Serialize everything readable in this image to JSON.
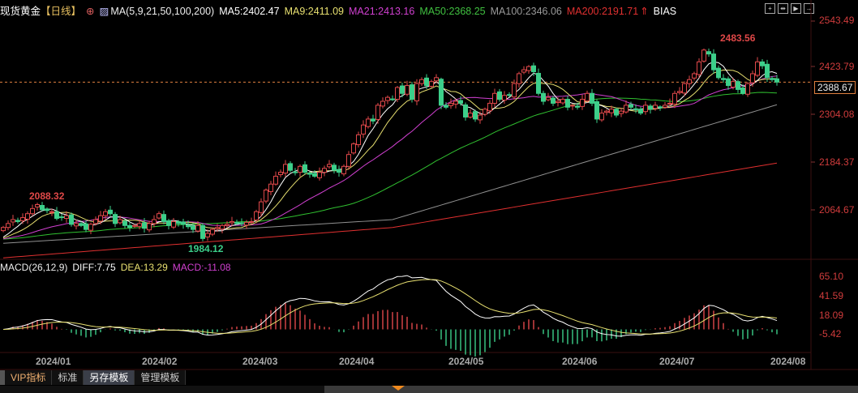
{
  "header": {
    "symbol": "现货黄金",
    "period": "【日线】",
    "ma_label": "MA(5,9,21,50,100,200)",
    "ma5": "MA5:2402.47",
    "ma9": "MA9:2411.09",
    "ma21": "MA21:2413.16",
    "ma50": "MA50:2368.25",
    "ma100": "MA100:2346.06",
    "ma200": "MA200:2191.71",
    "bias": "BIAS"
  },
  "macd_header": {
    "label": "MACD(26,12,9)",
    "diff": "DIFF:7.75",
    "dea": "DEA:13.29",
    "macd": "MACD:-11.08"
  },
  "tabs": [
    "VIP指标",
    "标准",
    "另存模板",
    "管理模板"
  ],
  "colors": {
    "up": "#e0484a",
    "down": "#3ccf8a",
    "ma5": "#ffffff",
    "ma9": "#e8e070",
    "ma21": "#d040d0",
    "ma50": "#30c030",
    "ma100": "#909090",
    "ma200": "#e03030"
  },
  "chart_data": {
    "type": "candlestick",
    "price_axis": {
      "ticks": [
        "2543.49",
        "2423.79",
        "2304.08",
        "2184.37",
        "2064.67"
      ],
      "range": [
        1943,
        2543.49
      ]
    },
    "current_price": "2388.67",
    "annotations": {
      "high1": "2088.32",
      "low1": "1984.12",
      "high2": "2483.56"
    },
    "x_labels": [
      "2024/01",
      "2024/02",
      "2024/03",
      "2024/04",
      "2024/05",
      "2024/06",
      "2024/07",
      "2024/08"
    ],
    "closes": [
      2020,
      2030,
      2040,
      2035,
      2045,
      2055,
      2068,
      2078,
      2065,
      2063,
      2060,
      2043,
      2045,
      2050,
      2028,
      2030,
      2025,
      2015,
      2028,
      2040,
      2050,
      2060,
      2055,
      2030,
      2040,
      2025,
      2020,
      2025,
      2030,
      2018,
      2030,
      2040,
      2055,
      2035,
      2025,
      2035,
      2030,
      2028,
      2022,
      2015,
      2025,
      1992,
      2005,
      2015,
      2020,
      2025,
      2028,
      2035,
      2030,
      2030,
      2033,
      2035,
      2060,
      2085,
      2115,
      2130,
      2150,
      2160,
      2180,
      2165,
      2160,
      2175,
      2160,
      2155,
      2150,
      2160,
      2170,
      2180,
      2165,
      2160,
      2175,
      2205,
      2232,
      2255,
      2280,
      2295,
      2290,
      2330,
      2340,
      2350,
      2345,
      2375,
      2360,
      2380,
      2345,
      2385,
      2395,
      2380,
      2390,
      2400,
      2330,
      2325,
      2335,
      2340,
      2335,
      2300,
      2310,
      2295,
      2305,
      2320,
      2335,
      2360,
      2345,
      2355,
      2355,
      2385,
      2410,
      2420,
      2428,
      2415,
      2360,
      2340,
      2350,
      2335,
      2340,
      2345,
      2325,
      2330,
      2325,
      2345,
      2360,
      2335,
      2295,
      2310,
      2315,
      2320,
      2305,
      2315,
      2330,
      2325,
      2320,
      2310,
      2330,
      2320,
      2330,
      2325,
      2330,
      2335,
      2360,
      2365,
      2385,
      2395,
      2410,
      2440,
      2470,
      2460,
      2420,
      2400,
      2395,
      2380,
      2390,
      2370,
      2360,
      2385,
      2410,
      2440,
      2430,
      2400,
      2395,
      2388.67
    ],
    "ma100_points": [
      [
        0,
        1980
      ],
      [
        80,
        2040
      ],
      [
        163,
        2346.06
      ]
    ],
    "ma200_points": [
      [
        0,
        1943
      ],
      [
        80,
        2020
      ],
      [
        163,
        2191.71
      ]
    ],
    "macd_axis": {
      "ticks": [
        "65.10",
        "41.59",
        "18.09",
        "-5.42"
      ],
      "range": [
        -5.42,
        65.1
      ]
    }
  }
}
